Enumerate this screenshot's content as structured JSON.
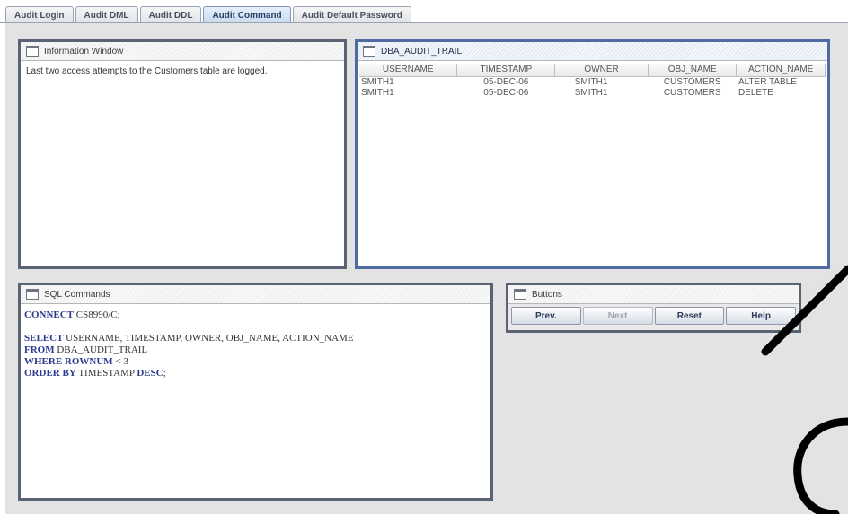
{
  "tabs": [
    {
      "label": "Audit Login",
      "active": false
    },
    {
      "label": "Audit DML",
      "active": false
    },
    {
      "label": "Audit DDL",
      "active": false
    },
    {
      "label": "Audit Command",
      "active": true
    },
    {
      "label": "Audit Default Password",
      "active": false
    }
  ],
  "info_window": {
    "title": "Information Window",
    "text": "Last two access attempts to the Customers table are logged."
  },
  "audit_trail": {
    "title": "DBA_AUDIT_TRAIL",
    "columns": [
      "USERNAME",
      "TIMESTAMP",
      "OWNER",
      "OBJ_NAME",
      "ACTION_NAME"
    ],
    "rows": [
      [
        "SMITH1",
        "05-DEC-06",
        "SMITH1",
        "CUSTOMERS",
        "ALTER TABLE"
      ],
      [
        "SMITH1",
        "05-DEC-06",
        "SMITH1",
        "CUSTOMERS",
        "DELETE"
      ]
    ]
  },
  "sql_commands": {
    "title": "SQL Commands",
    "connect_kw": "CONNECT",
    "connect_rest": " CS8990/C;",
    "select_kw": "SELECT",
    "select_rest": " USERNAME, TIMESTAMP, OWNER, OBJ_NAME, ACTION_NAME",
    "from_kw": "FROM",
    "from_rest": " DBA_AUDIT_TRAIL",
    "where_kw": "WHERE ROWNUM",
    "where_rest": " < 3",
    "order_kw": "ORDER BY",
    "order_mid": " TIMESTAMP ",
    "order_desc": "DESC",
    "order_end": ";"
  },
  "buttons": {
    "title": "Buttons",
    "prev": "Prev.",
    "next": "Next",
    "reset": "Reset",
    "help": "Help"
  },
  "icons": [
    "window-icon"
  ]
}
